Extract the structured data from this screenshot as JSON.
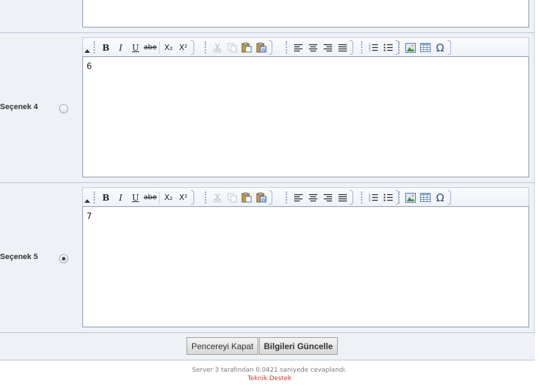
{
  "options": [
    {
      "label": "Seçenek 4",
      "content": "6",
      "selected": false
    },
    {
      "label": "Seçenek 5",
      "content": "7",
      "selected": true
    }
  ],
  "toolbar": {
    "bold": "B",
    "italic": "I",
    "underline": "U",
    "strike": "abe",
    "subscript": "X₂",
    "superscript": "X²",
    "special_char": "Ω"
  },
  "buttons": {
    "close": "Pencereyi Kapat",
    "update": "Bilgileri Güncelle"
  },
  "footer": {
    "server_text": "Server 3 tarafından 0.0421 saniyede cevaplandı.",
    "support_link": "Teknik Destek"
  },
  "colors": {
    "panel_bg": "#eef1f6",
    "link": "#c0392b"
  }
}
